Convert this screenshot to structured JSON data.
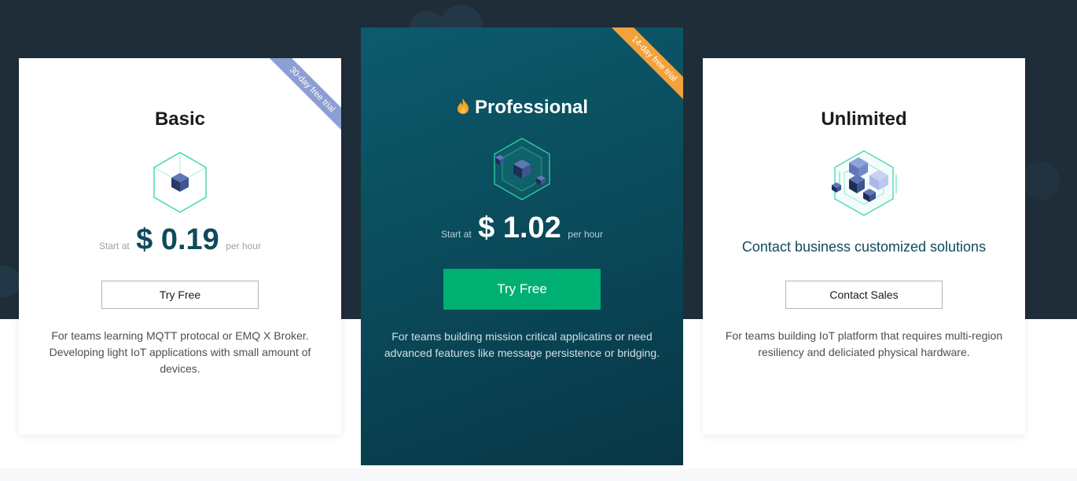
{
  "plans": {
    "basic": {
      "ribbon": "30-day free trial",
      "title": "Basic",
      "icon": "single-cube-icon",
      "price_prefix": "Start at",
      "price_value": "$ 0.19",
      "price_suffix": "per hour",
      "button_label": "Try Free",
      "description": "For teams learning MQTT protocal or EMQ X Broker. Developing light IoT applications with small amount of devices."
    },
    "professional": {
      "ribbon": "14-day free trial",
      "title": "Professional",
      "title_icon": "flame-icon",
      "icon": "nested-cubes-icon",
      "price_prefix": "Start at",
      "price_value": "$ 1.02",
      "price_suffix": "per hour",
      "button_label": "Try Free",
      "description": "For teams building mission critical applicatins or need advanced features like message persistence or bridging."
    },
    "unlimited": {
      "title": "Unlimited",
      "icon": "cube-cluster-icon",
      "contact_text": "Contact business customized solutions",
      "button_label": "Contact Sales",
      "description": "For teams building IoT platform that requires multi-region resiliency and deliciated physical hardware."
    }
  },
  "colors": {
    "background_dark": "#1f2d38",
    "professional_card": "#0a4a5a",
    "primary_button": "#00b073",
    "price_text": "#0e4a5c",
    "ribbon_blue": "#8c9fd3",
    "ribbon_orange": "#f2a13c",
    "flame": "#f5a623"
  }
}
